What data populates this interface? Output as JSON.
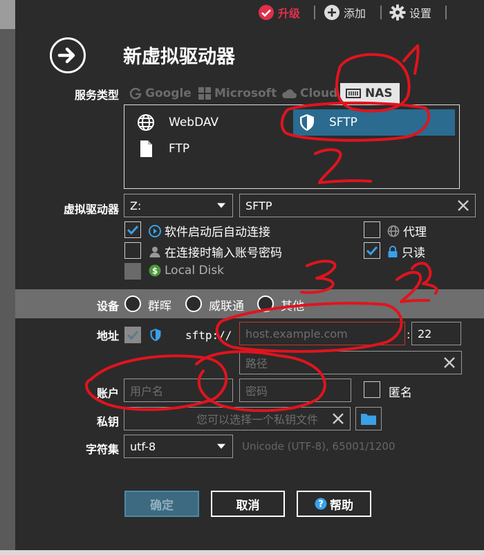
{
  "topbar": {
    "upgrade": "升级",
    "add": "添加",
    "settings": "设置",
    "upgrade_color": "#e0304a"
  },
  "dialog": {
    "title": "新虚拟驱动器",
    "service_type_label": "服务类型",
    "tabs": [
      {
        "label": "Google",
        "icon": "google-g-icon"
      },
      {
        "label": "Microsoft",
        "icon": "windows-icon"
      },
      {
        "label": "Cloud",
        "icon": "cloud-icon"
      },
      {
        "label": "NAS",
        "icon": "nas-icon",
        "active": true
      }
    ],
    "services": [
      {
        "label": "WebDAV",
        "icon": "globe-icon"
      },
      {
        "label": "FTP",
        "icon": "file-icon"
      },
      {
        "label": "SFTP",
        "icon": "shield-icon",
        "selected": true
      }
    ],
    "drive": {
      "label": "虚拟驱动器",
      "letter": "Z:",
      "name": "SFTP"
    },
    "options": {
      "auto_connect": "软件启动后自动连接",
      "proxy": "代理",
      "prompt_credentials": "在连接时输入账号密码",
      "readonly": "只读",
      "local_disk": "Local Disk"
    },
    "device": {
      "label": "设备",
      "options": [
        "群晖",
        "威联通",
        "其他"
      ]
    },
    "address": {
      "label": "地址",
      "scheme": "sftp://",
      "host_placeholder": "host.example.com",
      "port": "22",
      "path_placeholder": "路径"
    },
    "account": {
      "label": "账户",
      "username_placeholder": "用户名",
      "password_placeholder": "密码",
      "anonymous": "匿名"
    },
    "private_key": {
      "label": "私钥",
      "placeholder": "您可以选择一个私钥文件"
    },
    "charset": {
      "label": "字符集",
      "value": "utf-8",
      "hint": "Unicode (UTF-8), 65001/1200"
    },
    "buttons": {
      "ok": "确定",
      "cancel": "取消",
      "help": "帮助"
    }
  },
  "annotations": [
    "1",
    "2",
    "3",
    "2"
  ],
  "colors": {
    "panel_bg": "#2b2b2b",
    "selected_bg": "#2a6b8f",
    "check_blue": "#3aa0e8",
    "annotation_red": "#e0141e"
  }
}
